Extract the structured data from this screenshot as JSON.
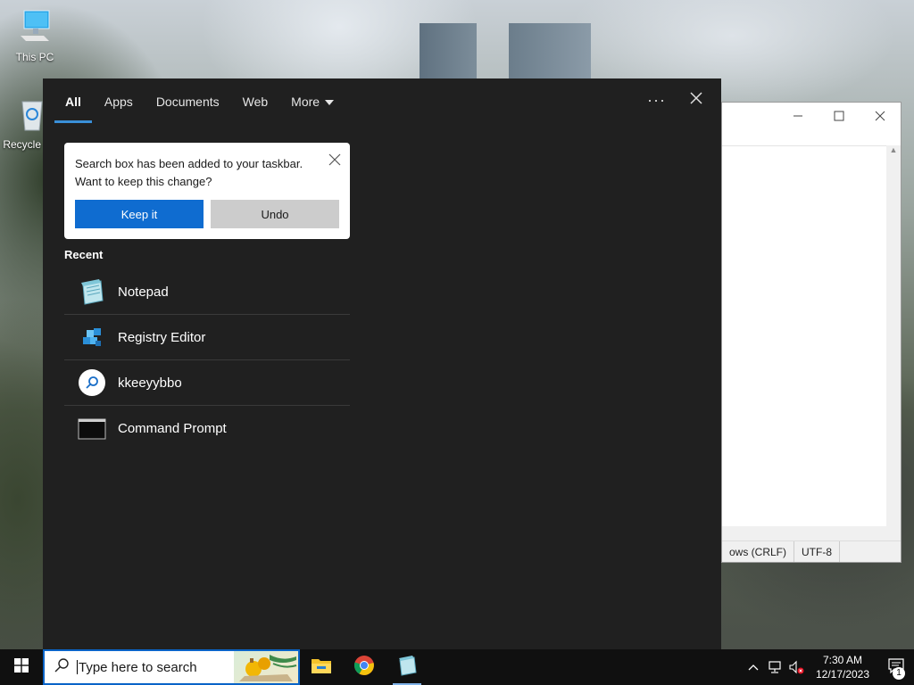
{
  "desktop": {
    "icons": [
      {
        "label": "This PC"
      },
      {
        "label": "Recycle Bin"
      }
    ]
  },
  "background_window": {
    "status_line_ending": "ows (CRLF)",
    "status_encoding": "UTF-8"
  },
  "search_panel": {
    "tabs": [
      {
        "label": "All",
        "active": true
      },
      {
        "label": "Apps"
      },
      {
        "label": "Documents"
      },
      {
        "label": "Web"
      },
      {
        "label": "More"
      }
    ],
    "toast": {
      "message": "Search box has been added to your taskbar. Want to keep this change?",
      "keep_label": "Keep it",
      "undo_label": "Undo"
    },
    "recent_label": "Recent",
    "recent_items": [
      {
        "label": "Notepad",
        "icon": "notepad-icon"
      },
      {
        "label": "Registry Editor",
        "icon": "registry-editor-icon"
      },
      {
        "label": "kkeeyybbo",
        "icon": "search-icon"
      },
      {
        "label": "Command Prompt",
        "icon": "command-prompt-icon"
      }
    ]
  },
  "taskbar": {
    "search_placeholder": "Type here to search",
    "apps": [
      {
        "name": "File Explorer",
        "icon": "file-explorer-icon"
      },
      {
        "name": "Google Chrome",
        "icon": "chrome-icon"
      },
      {
        "name": "Notepad",
        "icon": "notepad-icon",
        "open": true
      }
    ],
    "clock": {
      "time": "7:30 AM",
      "date": "12/17/2023"
    },
    "notification_count": "1"
  },
  "colors": {
    "accent": "#0f6cd0",
    "panel_bg": "#202020",
    "tab_underline": "#3a8fd8"
  }
}
